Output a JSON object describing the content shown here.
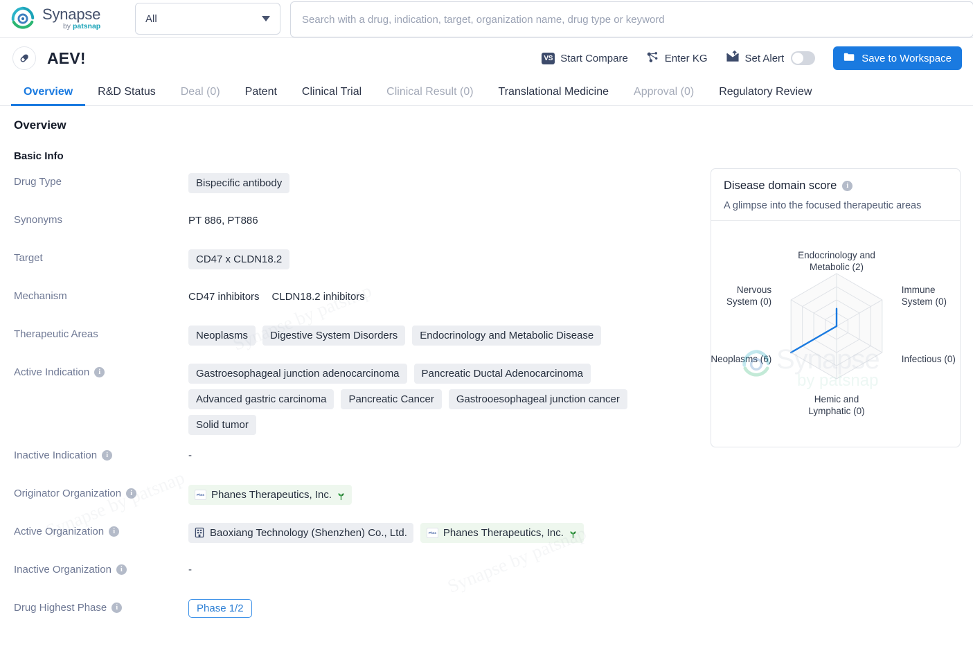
{
  "brand": {
    "name": "Synapse",
    "by": "by",
    "suffix": "patsnap"
  },
  "search": {
    "scope_value": "All",
    "placeholder": "Search with a drug, indication, target, organization name, drug type or keyword"
  },
  "drug_header": {
    "title": "AEV!",
    "start_compare": "Start Compare",
    "enter_kg": "Enter KG",
    "set_alert": "Set Alert",
    "alert_enabled": false,
    "save_to_workspace": "Save to Workspace",
    "save_button_color": "#1a7ae0"
  },
  "tabs": [
    {
      "label": "Overview",
      "state": "active"
    },
    {
      "label": "R&D Status",
      "state": "normal"
    },
    {
      "label": "Deal (0)",
      "state": "disabled"
    },
    {
      "label": "Patent",
      "state": "normal"
    },
    {
      "label": "Clinical Trial",
      "state": "normal"
    },
    {
      "label": "Clinical Result (0)",
      "state": "disabled"
    },
    {
      "label": "Translational Medicine",
      "state": "normal"
    },
    {
      "label": "Approval (0)",
      "state": "disabled"
    },
    {
      "label": "Regulatory Review",
      "state": "normal"
    }
  ],
  "overview": {
    "section_title": "Overview",
    "basic_info_title": "Basic Info",
    "labels": {
      "drug_type": "Drug Type",
      "synonyms": "Synonyms",
      "target": "Target",
      "mechanism": "Mechanism",
      "therapeutic_areas": "Therapeutic Areas",
      "active_indication": "Active Indication",
      "inactive_indication": "Inactive Indication",
      "originator_organization": "Originator Organization",
      "active_organization": "Active Organization",
      "inactive_organization": "Inactive Organization",
      "drug_highest_phase": "Drug Highest Phase"
    },
    "drug_type": [
      "Bispecific antibody"
    ],
    "synonyms": "PT 886,  PT886",
    "target": [
      "CD47 x CLDN18.2"
    ],
    "mechanism": [
      "CD47 inhibitors",
      "CLDN18.2 inhibitors"
    ],
    "therapeutic_areas": [
      "Neoplasms",
      "Digestive System Disorders",
      "Endocrinology and Metabolic Disease"
    ],
    "active_indication": [
      "Gastroesophageal junction adenocarcinoma",
      "Pancreatic Ductal Adenocarcinoma",
      "Advanced gastric carcinoma",
      "Pancreatic Cancer",
      "Gastrooesophageal junction cancer",
      "Solid tumor"
    ],
    "inactive_indication": "-",
    "originator_organization": [
      {
        "name": "Phanes Therapeutics, Inc.",
        "style": "green",
        "logo": "phanes-logo",
        "sprout": true
      }
    ],
    "active_organization": [
      {
        "name": "Baoxiang Technology (Shenzhen) Co., Ltd.",
        "style": "grey",
        "logo": "building-icon",
        "sprout": false
      },
      {
        "name": "Phanes Therapeutics, Inc.",
        "style": "green",
        "logo": "phanes-logo",
        "sprout": true
      }
    ],
    "inactive_organization": "-",
    "drug_highest_phase": "Phase 1/2"
  },
  "score_card": {
    "title": "Disease domain score",
    "subtitle": "A glimpse into the focused therapeutic areas",
    "watermark_name": "Synapse",
    "watermark_sub": "by patsnap"
  },
  "chart_data": {
    "type": "radar",
    "title": "Disease domain score",
    "subtitle": "A glimpse into the focused therapeutic areas",
    "categories": [
      "Endocrinology and Metabolic",
      "Immune System",
      "Infectious",
      "Hemic and Lymphatic",
      "Neoplasms",
      "Nervous System"
    ],
    "tick_labels": [
      "Endocrinology and\nMetabolic (2)",
      "Immune\nSystem (0)",
      "Infectious (0)",
      "Hemic and\nLymphatic (0)",
      "Neoplasms (6)",
      "Nervous\nSystem (0)"
    ],
    "values": [
      2,
      0,
      0,
      0,
      6,
      0
    ],
    "max": 6,
    "rings": 4,
    "grid": true,
    "legend": false,
    "line_color": "#1a7ae0",
    "grid_color": "#dfe2e7"
  }
}
